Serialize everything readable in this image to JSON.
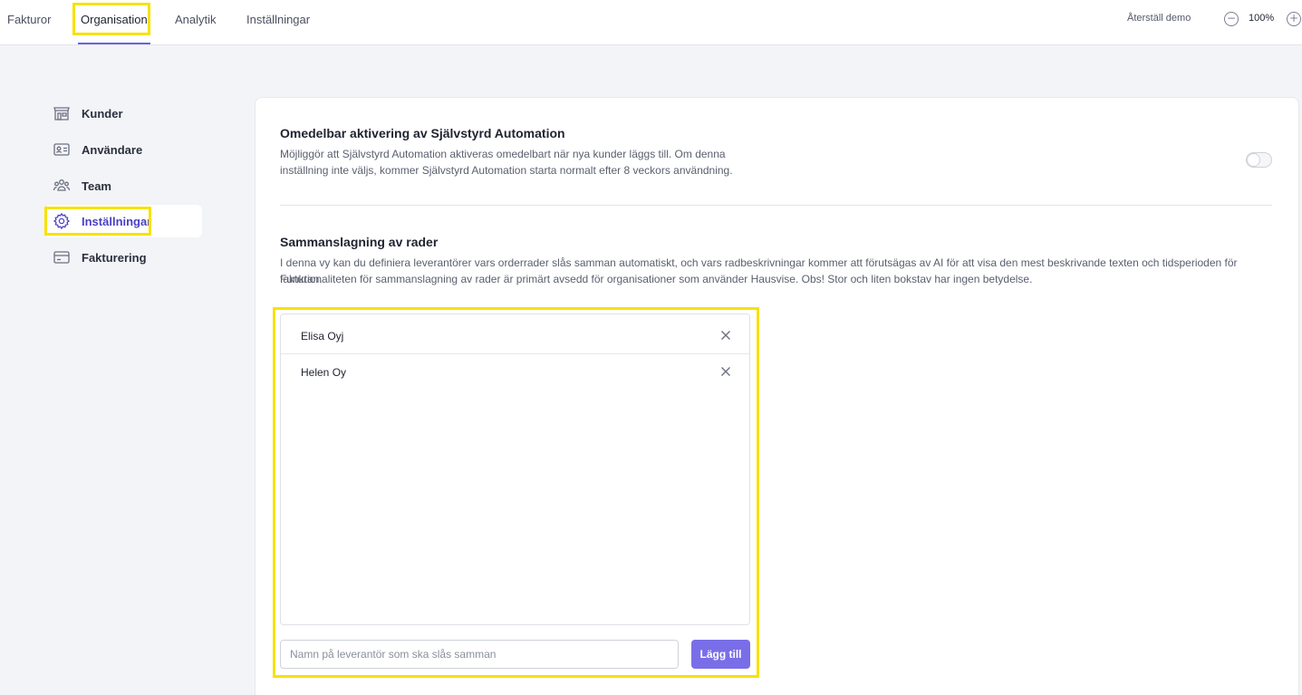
{
  "topbar": {
    "tabs": [
      {
        "label": "Fakturor"
      },
      {
        "label": "Organisation",
        "active": true
      },
      {
        "label": "Analytik"
      },
      {
        "label": "Inställningar"
      }
    ],
    "reset_demo": "Återställ demo",
    "zoom": "100%",
    "zoom_out_icon": "minus-circle-icon",
    "zoom_in_icon": "plus-circle-icon"
  },
  "sidebar": {
    "items": [
      {
        "label": "Kunder",
        "icon": "store-icon"
      },
      {
        "label": "Användare",
        "icon": "id-card-icon"
      },
      {
        "label": "Team",
        "icon": "users-icon"
      },
      {
        "label": "Inställningar",
        "icon": "gear-icon",
        "active": true
      },
      {
        "label": "Fakturering",
        "icon": "credit-card-icon"
      }
    ]
  },
  "settings": {
    "automation": {
      "title": "Omedelbar aktivering av Självstyrd Automation",
      "description_line1": "Möjliggör att Självstyrd Automation aktiveras omedelbart när nya kunder läggs till. Om denna",
      "description_line2": "inställning inte väljs, kommer Självstyrd Automation starta normalt efter 8 veckors användning.",
      "enabled": false
    },
    "merge": {
      "title": "Sammanslagning av rader",
      "description_line1": "I denna vy kan du definiera leverantörer vars orderrader slås samman automatiskt, och vars radbeskrivningar kommer att förutsägas av AI för att visa den mest beskrivande texten och tidsperioden för fakturan.",
      "description_line2": "Funktionaliteten för sammanslagning av rader är primärt avsedd för organisationer som använder Hausvise. Obs! Stor och liten bokstav har ingen betydelse.",
      "suppliers": [
        "Elisa Oyj",
        "Helen Oy"
      ],
      "input_placeholder": "Namn på leverantör som ska slås samman",
      "input_value": "",
      "add_button": "Lägg till"
    }
  },
  "colors": {
    "accent": "#6c63d9",
    "button": "#7a6ee8",
    "highlight": "#f7e200",
    "background": "#f3f4f8"
  }
}
